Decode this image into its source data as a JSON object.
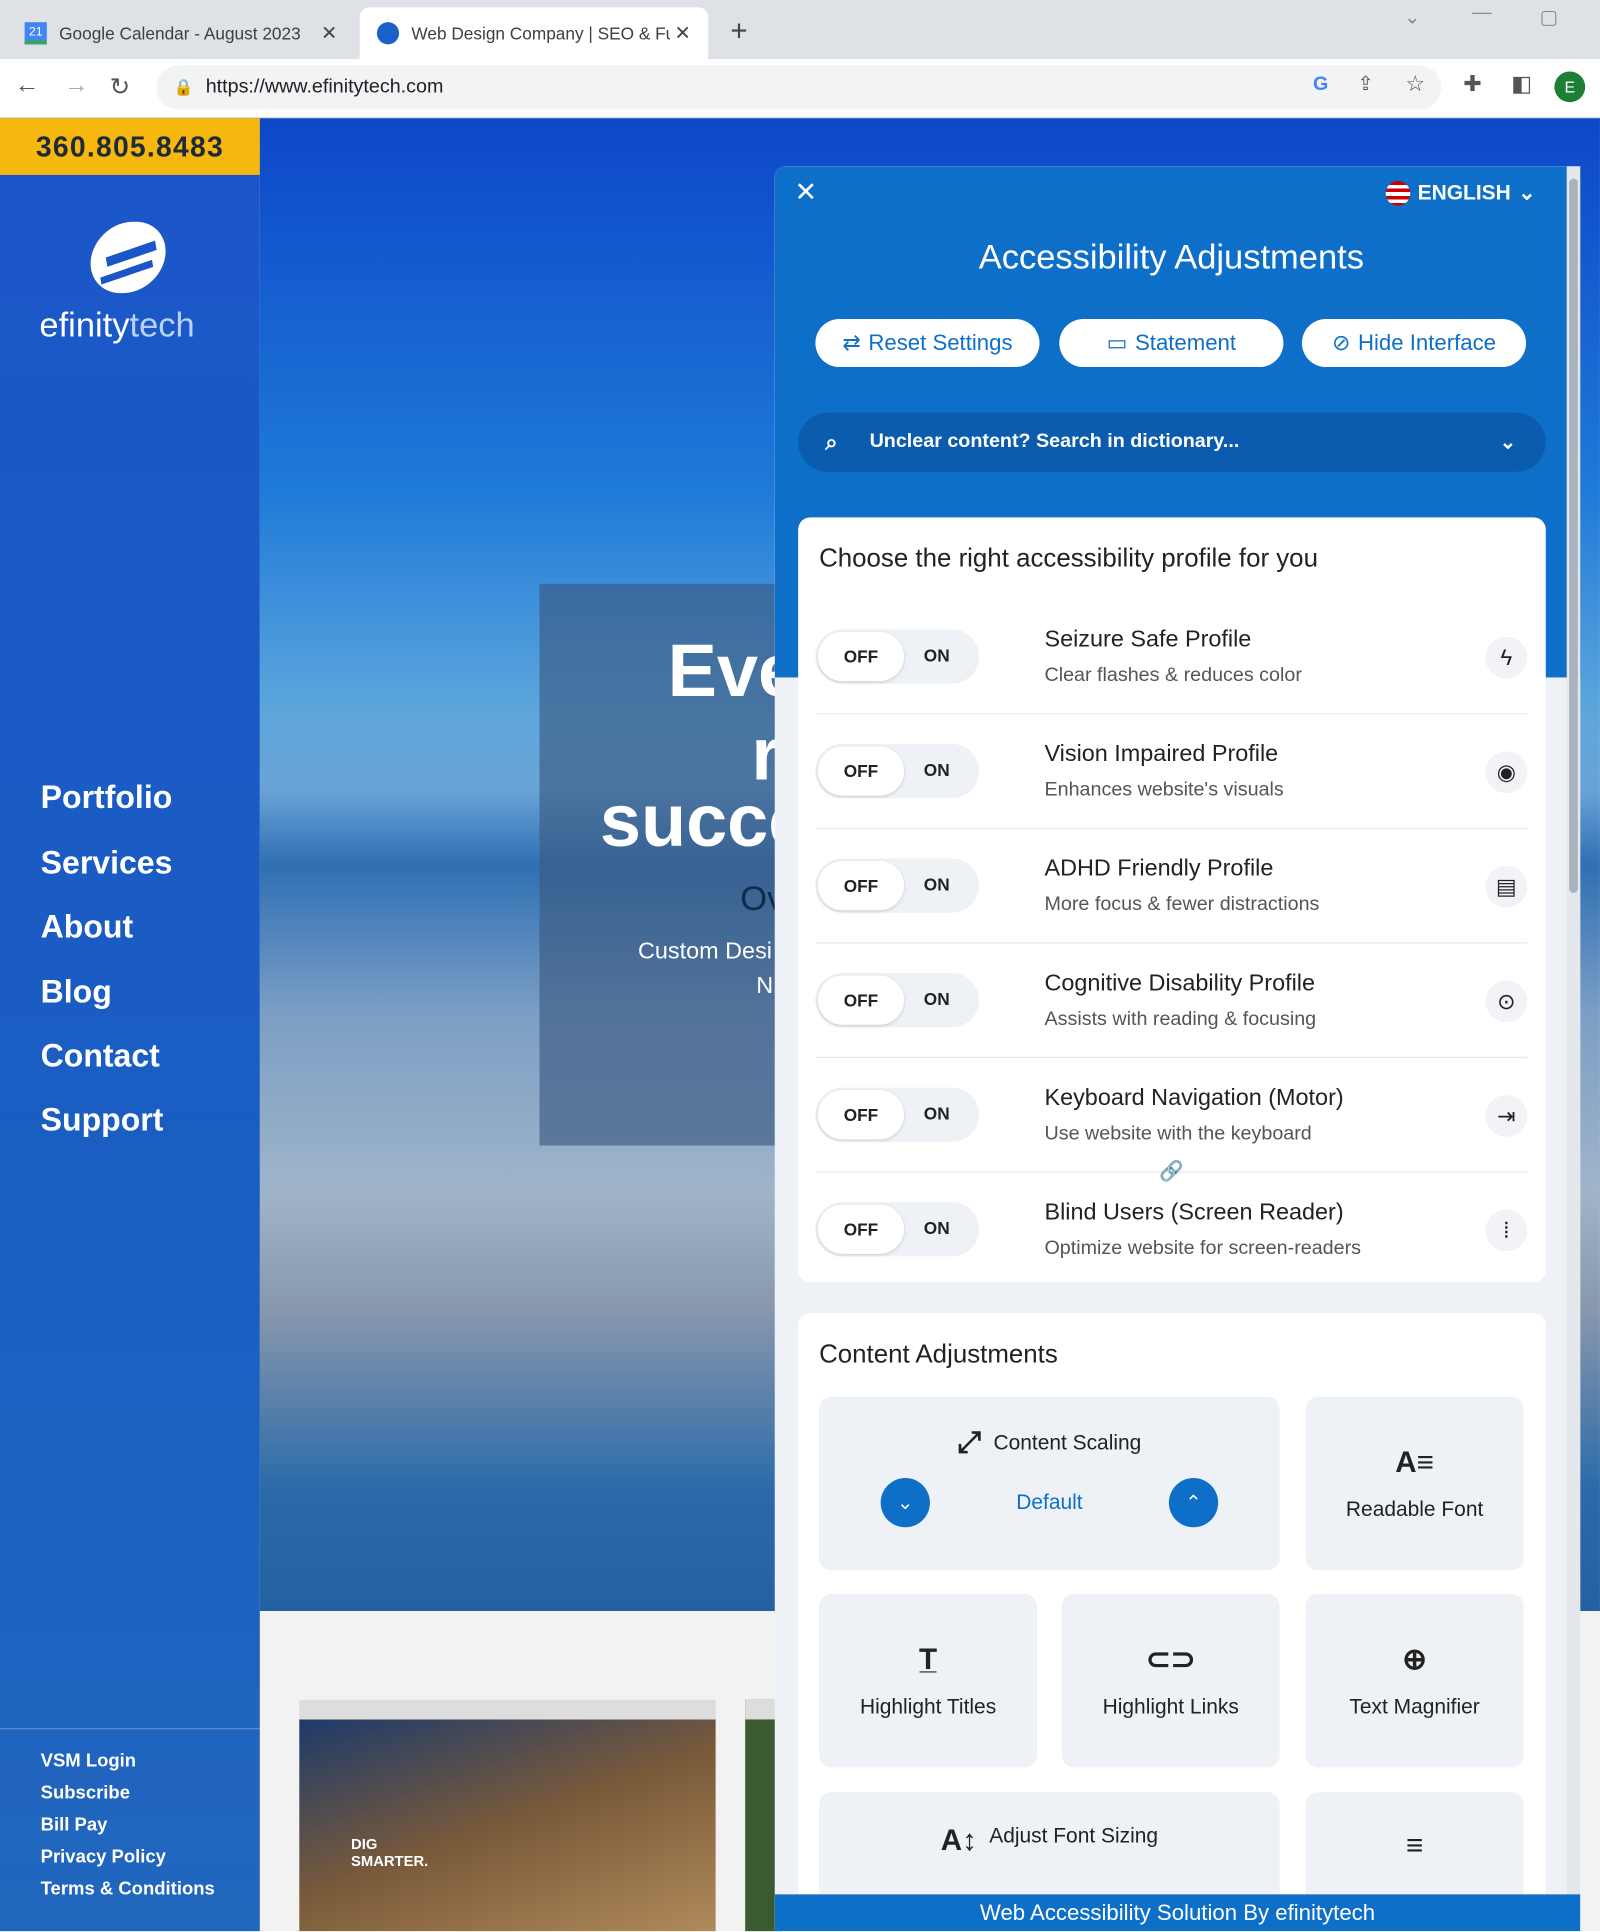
{
  "browser": {
    "tabs": [
      {
        "title": "Google Calendar - August 2023",
        "icon": "calendar-icon"
      },
      {
        "title": "Web Design Company | SEO & Fu",
        "icon": "efinitytech-icon"
      }
    ],
    "url": "https://www.efinitytech.com",
    "profile_initial": "E"
  },
  "site": {
    "phone": "360.805.8483",
    "logo_text_a": "efinity",
    "logo_text_b": "tech",
    "nav": [
      "Portfolio",
      "Services",
      "About",
      "Blog",
      "Contact",
      "Support"
    ],
    "footer_links": [
      "VSM Login",
      "Subscribe",
      "Bill Pay",
      "Privacy Policy",
      "Terms & Conditions"
    ],
    "hero": {
      "line1": "Eve",
      "line2": "r",
      "line3": "succe",
      "sub": "Ov",
      "desc1": "Custom Desi",
      "desc2": "N"
    },
    "thumb": {
      "headline": "DIG SMARTER."
    }
  },
  "panel": {
    "language": "ENGLISH",
    "title": "Accessibility Adjustments",
    "buttons": [
      "Reset Settings",
      "Statement",
      "Hide Interface"
    ],
    "search_placeholder": "Unclear content? Search in dictionary...",
    "profiles_heading": "Choose the right accessibility profile for you",
    "toggle_off": "OFF",
    "toggle_on": "ON",
    "profiles": [
      {
        "title": "Seizure Safe Profile",
        "sub": "Clear flashes & reduces color",
        "icon": "bolt-icon"
      },
      {
        "title": "Vision Impaired Profile",
        "sub": "Enhances website's visuals",
        "icon": "eye-icon"
      },
      {
        "title": "ADHD Friendly Profile",
        "sub": "More focus & fewer distractions",
        "icon": "focus-box-icon"
      },
      {
        "title": "Cognitive Disability Profile",
        "sub": "Assists with reading & focusing",
        "icon": "target-icon"
      },
      {
        "title": "Keyboard Navigation (Motor)",
        "sub": "Use website with the keyboard",
        "icon": "arrow-tab-icon"
      },
      {
        "title": "Blind Users (Screen Reader)",
        "sub": "Optimize website for screen-readers",
        "icon": "audio-wave-icon"
      }
    ],
    "content_heading": "Content Adjustments",
    "scaling": {
      "label": "Content Scaling",
      "value": "Default"
    },
    "tiles": [
      "Readable Font",
      "Highlight Titles",
      "Highlight Links",
      "Text Magnifier",
      "Adjust Font Sizing"
    ],
    "footer": "Web Accessibility Solution By efinitytech"
  },
  "colors": {
    "accent": "#0e6fc8",
    "phone_bg": "#f6b80f",
    "sidebar": "#1b56c9"
  }
}
